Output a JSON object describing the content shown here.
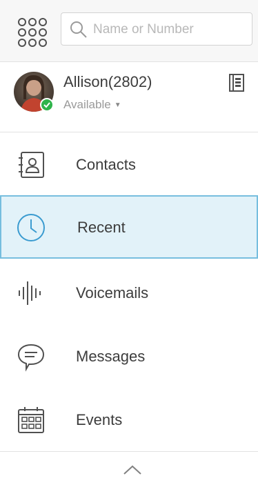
{
  "search": {
    "placeholder": "Name or Number"
  },
  "user": {
    "name": "Allison(2802)",
    "status": "Available"
  },
  "nav": {
    "items": [
      {
        "label": "Contacts",
        "icon": "contacts-icon"
      },
      {
        "label": "Recent",
        "icon": "clock-icon",
        "active": true
      },
      {
        "label": "Voicemails",
        "icon": "voicemail-waveform-icon"
      },
      {
        "label": "Messages",
        "icon": "message-bubble-icon"
      },
      {
        "label": "Events",
        "icon": "calendar-icon"
      }
    ]
  },
  "colors": {
    "active_bg": "#e2f2f9",
    "active_border": "#76bede",
    "accent_icon": "#3a9bd0",
    "presence_available": "#2eb34a"
  }
}
